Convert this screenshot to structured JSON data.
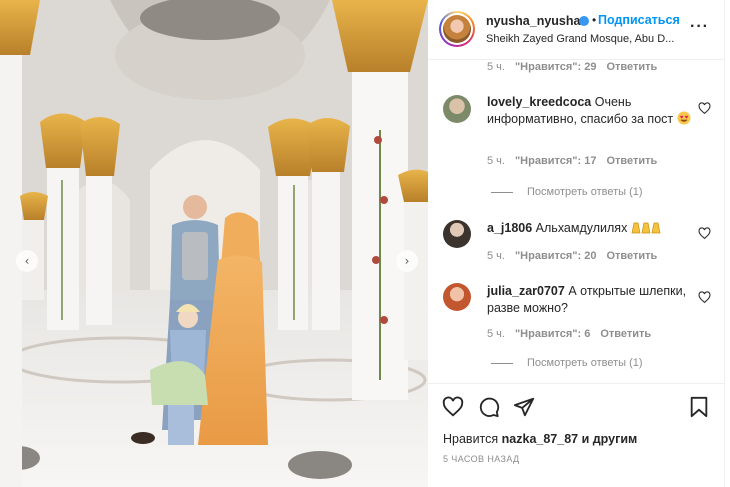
{
  "post": {
    "username": "nyusha_nyusha",
    "dot": "•",
    "follow_label": "Подписаться",
    "location": "Sheikh Zayed Grand Mosque, Abu D...",
    "more_label": "···"
  },
  "comments": [
    {
      "meta": {
        "time": "5 ч.",
        "likes": "\"Нравится\": 29",
        "reply": "Ответить"
      }
    },
    {
      "username": "lovely_kreedcoca",
      "text": "Очень информативно, спасибо за пост",
      "meta": {
        "time": "5 ч.",
        "likes": "\"Нравится\": 17",
        "reply": "Ответить"
      },
      "view_replies": "Посмотреть ответы (1)"
    },
    {
      "username": "a_j1806",
      "text": "Альхамдулилях",
      "meta": {
        "time": "5 ч.",
        "likes": "\"Нравится\": 20",
        "reply": "Ответить"
      }
    },
    {
      "username": "julia_zar0707",
      "text": "А открытые шлепки, разве можно?",
      "meta": {
        "time": "5 ч.",
        "likes": "\"Нравится\": 6",
        "reply": "Ответить"
      },
      "view_replies": "Посмотреть ответы (1)"
    }
  ],
  "footer": {
    "likes_prefix": "Нравится",
    "likes_user": "nazka_87_87",
    "likes_suffix": "и другим",
    "time_ago": "5 ЧАСОВ НАЗАД"
  },
  "photo": {
    "prev_icon": "‹",
    "next_icon": "›"
  },
  "icons": [
    "heart-icon",
    "comment-icon",
    "share-icon",
    "bookmark-icon",
    "chevron-left-icon",
    "chevron-right-icon",
    "verified-icon",
    "more-icon"
  ],
  "colors": {
    "accent": "#0095f6",
    "text": "#262626",
    "muted": "#8e8e8e",
    "verified": "#3897f0"
  }
}
